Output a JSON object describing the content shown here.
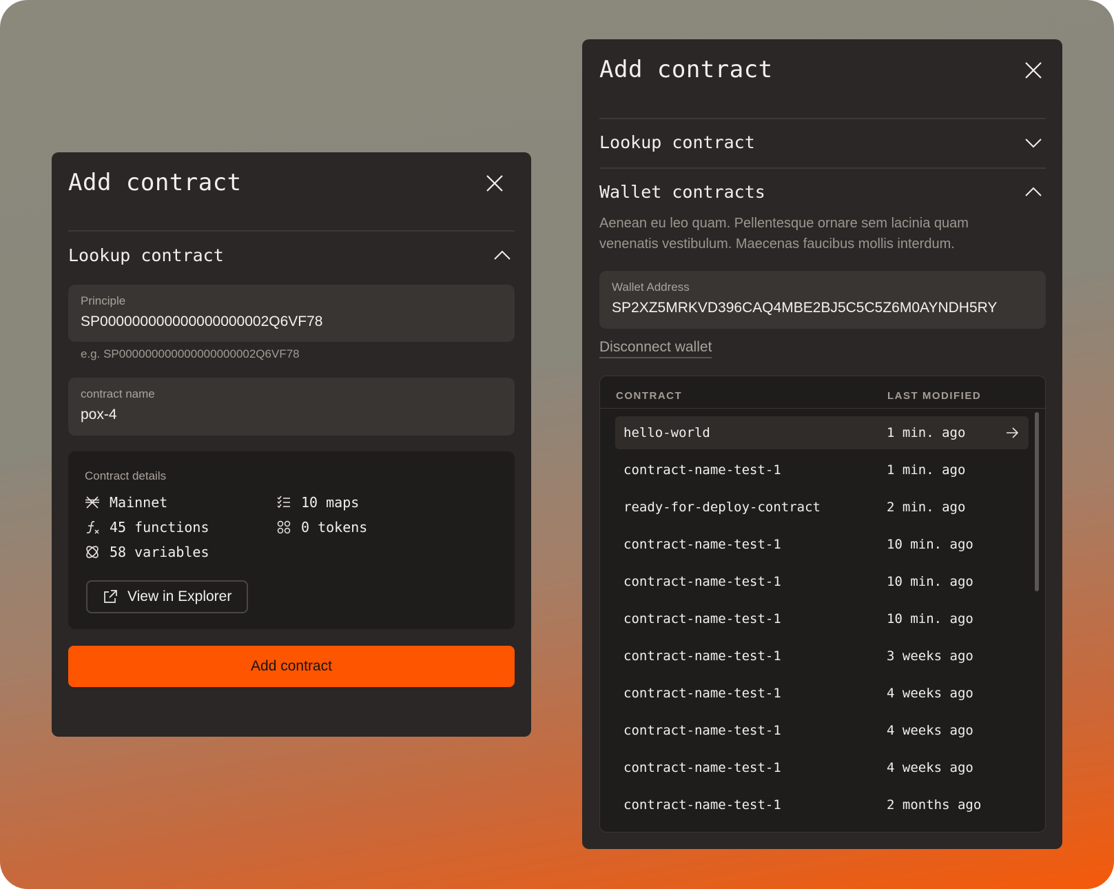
{
  "left_panel": {
    "title": "Add contract",
    "lookup_section": "Lookup contract",
    "principle": {
      "label": "Principle",
      "value": "SP000000000000000000002Q6VF78",
      "hint": "e.g. SP000000000000000000002Q6VF78"
    },
    "contract_name": {
      "label": "contract name",
      "value": "pox-4"
    },
    "details": {
      "title": "Contract details",
      "items": [
        {
          "icon": "network-icon",
          "text": "Mainnet"
        },
        {
          "icon": "function-icon",
          "text": "45 functions"
        },
        {
          "icon": "variables-icon",
          "text": "58 variables"
        },
        {
          "icon": "list-check-icon",
          "text": "10 maps"
        },
        {
          "icon": "tokens-icon",
          "text": "0 tokens"
        }
      ],
      "explorer_label": "View in Explorer"
    },
    "add_button": "Add contract"
  },
  "right_panel": {
    "title": "Add contract",
    "lookup_section": "Lookup contract",
    "wallet_section": "Wallet contracts",
    "description": "Aenean eu leo quam. Pellentesque ornare sem lacinia quam venenatis vestibulum. Maecenas faucibus mollis interdum.",
    "wallet": {
      "label": "Wallet Address",
      "value": "SP2XZ5MRKVD396CAQ4MBE2BJ5C5C5Z6M0AYNDH5RY"
    },
    "disconnect": "Disconnect wallet",
    "table": {
      "headers": [
        "CONTRACT",
        "LAST MODIFIED"
      ],
      "rows": [
        {
          "name": "hello-world",
          "modified": "1 min. ago"
        },
        {
          "name": "contract-name-test-1",
          "modified": "1 min. ago"
        },
        {
          "name": "ready-for-deploy-contract",
          "modified": "2 min. ago"
        },
        {
          "name": "contract-name-test-1",
          "modified": "10 min. ago"
        },
        {
          "name": "contract-name-test-1",
          "modified": "10 min. ago"
        },
        {
          "name": "contract-name-test-1",
          "modified": "10 min. ago"
        },
        {
          "name": "contract-name-test-1",
          "modified": "3 weeks ago"
        },
        {
          "name": "contract-name-test-1",
          "modified": "4 weeks ago"
        },
        {
          "name": "contract-name-test-1",
          "modified": "4 weeks ago"
        },
        {
          "name": "contract-name-test-1",
          "modified": "4 weeks ago"
        },
        {
          "name": "contract-name-test-1",
          "modified": "2 months ago"
        }
      ]
    }
  },
  "colors": {
    "accent": "#fe5500",
    "panel": "#2a2726"
  }
}
